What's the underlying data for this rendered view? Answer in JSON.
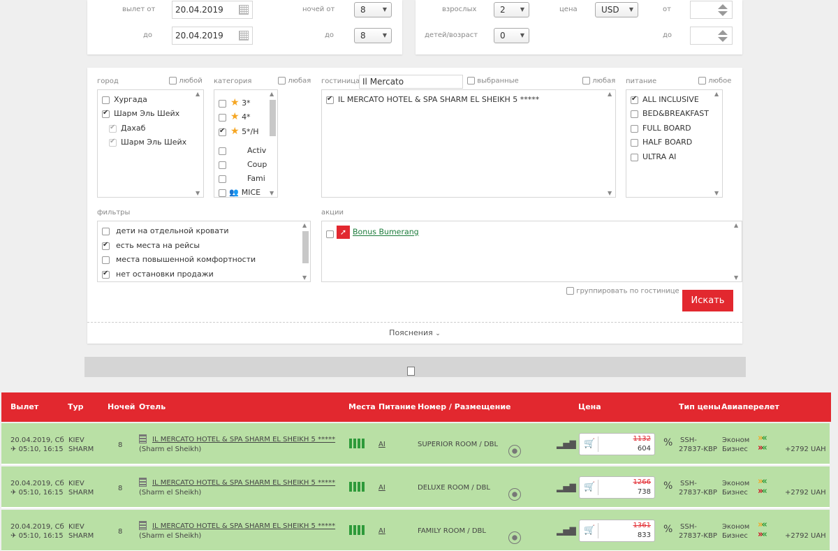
{
  "search": {
    "depart_from_label": "вылет от",
    "depart_from": "20.04.2019",
    "depart_to_label": "до",
    "depart_to": "20.04.2019",
    "nights_from_label": "ночей от",
    "nights_from": "8",
    "nights_to_label": "до",
    "nights_to": "8",
    "adults_label": "взрослых",
    "adults": "2",
    "children_label": "детей/возраст",
    "children": "0",
    "price_label": "цена",
    "currency": "USD",
    "price_from_label": "от",
    "price_to_label": "до"
  },
  "city": {
    "label": "город",
    "any_label": "любой",
    "items": [
      {
        "label": "Хургада",
        "checked": false
      },
      {
        "label": "Шарм Эль Шейх",
        "checked": true
      },
      {
        "label": "Дахаб",
        "checked": true
      },
      {
        "label": "Шарм Эль Шейх",
        "checked": true
      }
    ]
  },
  "category": {
    "label": "категория",
    "any_label": "любая",
    "stars": [
      {
        "label": "3*",
        "checked": false
      },
      {
        "label": "4*",
        "checked": false
      },
      {
        "label": "5*/H",
        "checked": true
      }
    ],
    "types": [
      "Activ",
      "Coup",
      "Fami",
      "MICE"
    ]
  },
  "hotel": {
    "label": "гостиница",
    "search_value": "Il Mercato",
    "selected_label": "выбранные",
    "any_label": "любая",
    "items": [
      {
        "label": "IL MERCATO HOTEL & SPA SHARM EL SHEIKH 5 *****",
        "checked": true
      }
    ]
  },
  "meal": {
    "label": "питание",
    "any_label": "любое",
    "items": [
      {
        "label": "ALL INCLUSIVE",
        "checked": true
      },
      {
        "label": "BED&BREAKFAST",
        "checked": false
      },
      {
        "label": "FULL BOARD",
        "checked": false
      },
      {
        "label": "HALF BOARD",
        "checked": false
      },
      {
        "label": "ULTRA AI",
        "checked": false
      }
    ]
  },
  "filters": {
    "label": "фильтры",
    "items": [
      {
        "label": "дети на отдельной кровати",
        "checked": false
      },
      {
        "label": "есть места на рейсы",
        "checked": true
      },
      {
        "label": "места повышенной комфортности",
        "checked": false
      },
      {
        "label": "нет остановки продажи",
        "checked": true
      }
    ]
  },
  "promos": {
    "label": "акции",
    "items": [
      {
        "label": "Bonus Bumerang",
        "checked": false
      }
    ]
  },
  "group_by_hotel_label": "группировать по гостинице",
  "search_button": "Искать",
  "explanations_label": "Пояснения",
  "results": {
    "headers": {
      "departure": "Вылет",
      "tour": "Тур",
      "nights": "Ночей",
      "hotel": "Отель",
      "seats": "Места",
      "meal": "Питание",
      "room": "Номер / Размещение",
      "price": "Цена",
      "price_type": "Тип цены",
      "flight": "Авиаперелет"
    },
    "rows": [
      {
        "date": "20.04.2019, Сб",
        "times": "05:10, 16:15",
        "tour_from": "KIEV",
        "tour_to": "SHARM",
        "nights": "8",
        "hotel": "IL MERCATO HOTEL & SPA SHARM EL SHEIKH 5 *****",
        "city": "(Sharm el Sheikh)",
        "meal": "AI",
        "room": "SUPERIOR ROOM / DBL",
        "old_price": "1132",
        "price": "604",
        "percent": "%",
        "price_type_1": "SSH-",
        "price_type_2": "27837-KBP",
        "class_1": "Эконом",
        "class_2": "Бизнес",
        "surcharge": "+2792 UAH"
      },
      {
        "date": "20.04.2019, Сб",
        "times": "05:10, 16:15",
        "tour_from": "KIEV",
        "tour_to": "SHARM",
        "nights": "8",
        "hotel": "IL MERCATO HOTEL & SPA SHARM EL SHEIKH 5 *****",
        "city": "(Sharm el Sheikh)",
        "meal": "AI",
        "room": "DELUXE ROOM / DBL",
        "old_price": "1266",
        "price": "738",
        "percent": "%",
        "price_type_1": "SSH-",
        "price_type_2": "27837-KBP",
        "class_1": "Эконом",
        "class_2": "Бизнес",
        "surcharge": "+2792 UAH"
      },
      {
        "date": "20.04.2019, Сб",
        "times": "05:10, 16:15",
        "tour_from": "KIEV",
        "tour_to": "SHARM",
        "nights": "8",
        "hotel": "IL MERCATO HOTEL & SPA SHARM EL SHEIKH 5 *****",
        "city": "(Sharm el Sheikh)",
        "meal": "AI",
        "room": "FAMILY ROOM / DBL",
        "old_price": "1361",
        "price": "833",
        "percent": "%",
        "price_type_1": "SSH-",
        "price_type_2": "27837-KBP",
        "class_1": "Эконом",
        "class_2": "Бизнес",
        "surcharge": "+2792 UAH"
      }
    ]
  },
  "colors": {
    "accent_red": "#e2282f",
    "row_green": "#b9e0a5",
    "link_green": "#1a7b3a",
    "chevron_orange": "#f5a623",
    "chevron_green": "#2e9a3a",
    "chevron_red": "#d0021b"
  },
  "icons": [
    "calendar-icon",
    "star-icon",
    "group-icon",
    "bonus-logo-icon",
    "document-icon",
    "hotel-icon",
    "seats-icon",
    "room-photo-icon",
    "stats-icon",
    "cart-icon",
    "flight-arrows-icon",
    "plane-icon"
  ]
}
